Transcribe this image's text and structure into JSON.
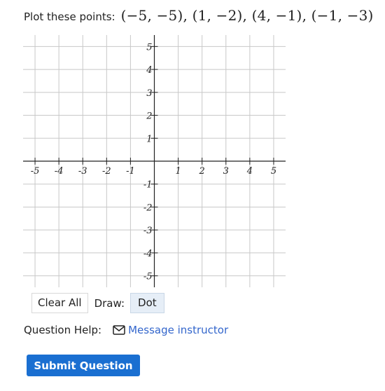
{
  "question": {
    "label": "Plot these points:",
    "points_text": "(−5, −5), (1, −2), (4, −1), (−1, −3)"
  },
  "graph": {
    "x_range": [
      -5.5,
      5.5
    ],
    "y_range": [
      -5.5,
      5.5
    ],
    "x_ticks": [
      "-5",
      "-4",
      "-3",
      "-2",
      "-1",
      "1",
      "2",
      "3",
      "4",
      "5"
    ],
    "y_ticks": [
      "5",
      "4",
      "3",
      "2",
      "1",
      "-1",
      "-2",
      "-3",
      "-4",
      "-5"
    ],
    "grid_color": "#c8c8c8",
    "axis_color": "#222222"
  },
  "controls": {
    "clear_all": "Clear All",
    "draw_label": "Draw:",
    "dot": "Dot"
  },
  "help": {
    "label": "Question Help:",
    "message_link": "Message instructor",
    "icon": "envelope-icon"
  },
  "submit": {
    "label": "Submit Question",
    "color": "#1a6fd1"
  }
}
